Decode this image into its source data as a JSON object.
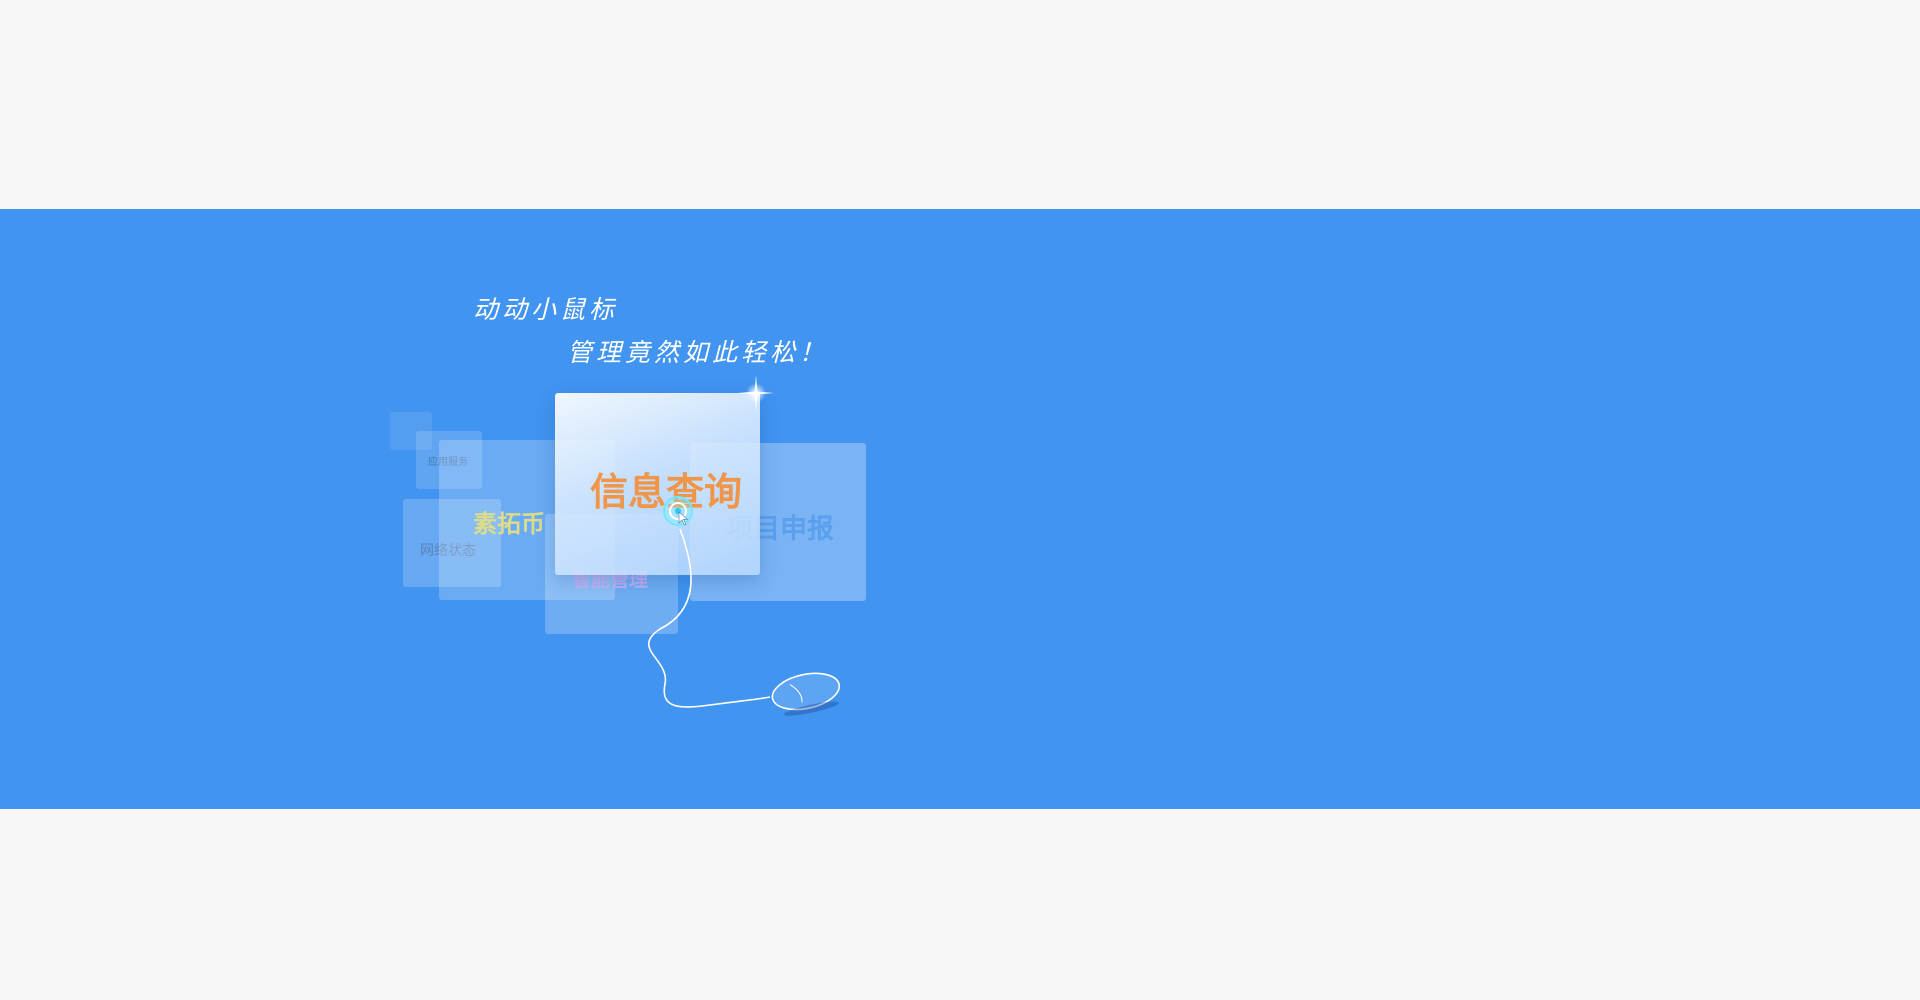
{
  "banner": {
    "background_color": "#4194f0",
    "slogan": {
      "line1": "动动小鼠标",
      "line2": "管理竟然如此轻松！"
    },
    "tiles": {
      "main": "信息查询",
      "report": "项目申报",
      "coin": "素拓币",
      "management": "智能管理",
      "network": "网络状态",
      "service": "应用服务"
    },
    "icons": [
      "sparkle-icon",
      "cursor-icon",
      "mouse-icon"
    ]
  }
}
